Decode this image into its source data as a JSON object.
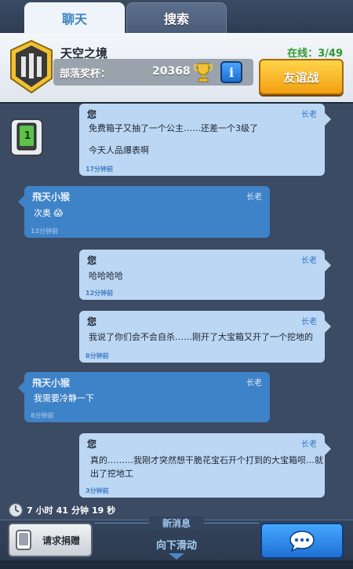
{
  "tabs": {
    "chat": "聊天",
    "search": "搜索"
  },
  "clan": {
    "name": "天空之境",
    "online_label": "在线：",
    "online_count": "3/49",
    "trophy_label": "部落奖杯：",
    "trophy_value": "20368",
    "info_label": "i",
    "friendly_battle": "友谊战"
  },
  "donation_card": {
    "level": "1"
  },
  "messages": [
    {
      "sender": "您",
      "role": "长老",
      "lines": [
        "免费箱子又抽了一个公主……还差一个3级了",
        "今天人品爆表啊"
      ],
      "time": "17分钟前"
    },
    {
      "sender": "飛天小猴",
      "role": "长老",
      "lines": [
        "次奥 😱"
      ],
      "time": "12分钟前"
    },
    {
      "sender": "您",
      "role": "长老",
      "lines": [
        "哈哈哈哈"
      ],
      "time": "12分钟前"
    },
    {
      "sender": "您",
      "role": "长老",
      "lines": [
        "我说了你们会不会自杀……刚开了大宝箱又开了一个挖地的"
      ],
      "time": "8分钟前"
    },
    {
      "sender": "飛天小猴",
      "role": "长老",
      "lines": [
        "我需要冷静一下"
      ],
      "time": "8分钟前"
    },
    {
      "sender": "您",
      "role": "长老",
      "lines": [
        "真的………我刚才突然想干脆花宝石开个打到的大宝箱呗…就",
        "出了挖地工"
      ],
      "time": "3分钟前"
    }
  ],
  "timer": {
    "hours": "7",
    "hours_unit": "小时",
    "minutes": "41",
    "minutes_unit": "分钟",
    "seconds": "19",
    "seconds_unit": "秒"
  },
  "bottom": {
    "new_messages": "新消息",
    "scroll_down": "向下滑动",
    "request_donation": "请求捐赠"
  },
  "colors": {
    "background": "#3b4b63",
    "my_bubble": "#bcd7f4",
    "other_bubble": "#3e82c7",
    "friendly_button": "#f2a011",
    "compose_button": "#1f70d4",
    "online_green": "#2e9a2f"
  },
  "icons": {
    "clan_badge": "clan-badge-icon",
    "trophy": "trophy-icon",
    "info": "info-icon",
    "card": "card-icon",
    "clock": "clock-icon",
    "chat": "chat-bubble-icon"
  }
}
